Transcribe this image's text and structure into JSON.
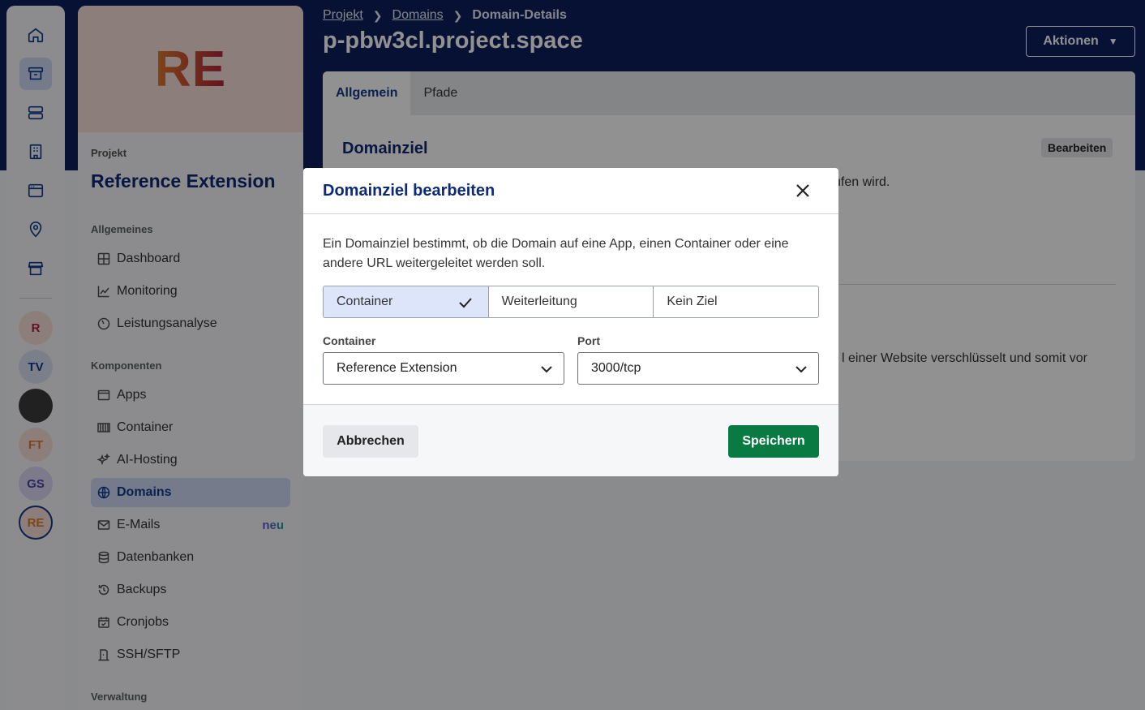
{
  "rail": {
    "icons": [
      "home-icon",
      "archive-icon",
      "server-icon",
      "building-icon",
      "browser-window-icon",
      "map-pin-icon",
      "store-icon"
    ],
    "avatars": [
      {
        "initials": "R",
        "bg": "#f6ddd6",
        "fg": "#b0213d"
      },
      {
        "initials": "TV",
        "bg": "#d9e0f3",
        "fg": "#123a8c"
      },
      {
        "initials": "",
        "bg": "#3a3a3a",
        "fg": "#ffffff"
      },
      {
        "initials": "FT",
        "bg": "#f6ddd6",
        "fg": "#e07a2a"
      },
      {
        "initials": "GS",
        "bg": "#dcd7f3",
        "fg": "#4b43a6"
      },
      {
        "initials": "RE",
        "bg": "#f6ddd6",
        "fg": "#e07a2a"
      }
    ]
  },
  "sidebar": {
    "initials": "RE",
    "project_label": "Projekt",
    "project_name": "Reference Extension",
    "sections": {
      "general": "Allgemeines",
      "components": "Komponenten",
      "admin": "Verwaltung"
    },
    "items": [
      {
        "label": "Dashboard",
        "icon": "grid-icon"
      },
      {
        "label": "Monitoring",
        "icon": "chart-line-icon"
      },
      {
        "label": "Leistungsanalyse",
        "icon": "gauge-icon"
      },
      {
        "label": "Apps",
        "icon": "app-window-icon"
      },
      {
        "label": "Container",
        "icon": "container-icon"
      },
      {
        "label": "AI-Hosting",
        "icon": "sparkles-icon"
      },
      {
        "label": "Domains",
        "icon": "globe-icon",
        "active": true
      },
      {
        "label": "E-Mails",
        "icon": "mail-icon",
        "badge": "neu"
      },
      {
        "label": "Datenbanken",
        "icon": "database-icon"
      },
      {
        "label": "Backups",
        "icon": "history-icon"
      },
      {
        "label": "Cronjobs",
        "icon": "calendar-check-icon"
      },
      {
        "label": "SSH/SFTP",
        "icon": "door-icon"
      }
    ]
  },
  "header": {
    "breadcrumb": [
      "Projekt",
      "Domains",
      "Domain-Details"
    ],
    "title": "p-pbw3cl.project.space",
    "actions_label": "Aktionen"
  },
  "card": {
    "tabs": [
      "Allgemein",
      "Pfade"
    ],
    "heading": "Domainziel",
    "edit_label": "Bearbeiten",
    "text1": "ufen wird.",
    "text2": "l einer Website verschlüsselt und somit vor"
  },
  "modal": {
    "title": "Domainziel bearbeiten",
    "description": "Ein Domainziel bestimmt, ob die Domain auf eine App, einen Container oder eine andere URL weitergeleitet werden soll.",
    "options": [
      "Container",
      "Weiterleitung",
      "Kein Ziel"
    ],
    "selected_option": "Container",
    "container_label": "Container",
    "container_value": "Reference Extension",
    "port_label": "Port",
    "port_value": "3000/tcp",
    "cancel_label": "Abbrechen",
    "save_label": "Speichern"
  },
  "colors": {
    "header_bg": "#0b1e5c",
    "accent": "#123a8c",
    "save_button": "#0a7a43"
  }
}
